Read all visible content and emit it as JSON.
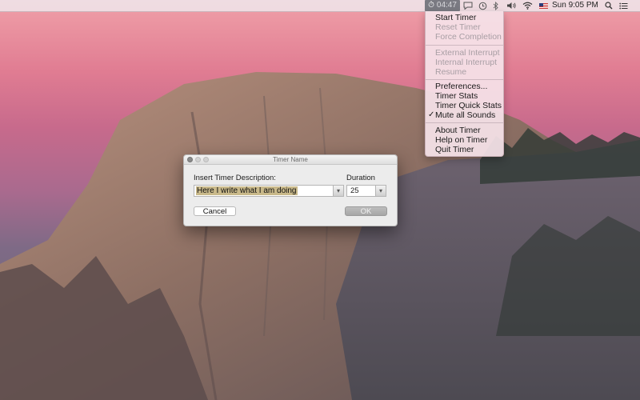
{
  "menubar": {
    "timer_time": "04:47",
    "clock": "Sun 9:05 PM",
    "icons": [
      "stopwatch-icon",
      "chat-bubble-icon",
      "time-machine-icon",
      "bluetooth-icon",
      "volume-icon",
      "wifi-icon",
      "us-flag-icon",
      "spotlight-search-icon",
      "notification-center-icon"
    ]
  },
  "menu": {
    "start_timer": "Start Timer",
    "reset_timer": "Reset Timer",
    "force_completion": "Force Completion",
    "external_interrupt": "External Interrupt",
    "internal_interrupt": "Internal Interrupt",
    "resume": "Resume",
    "preferences": "Preferences...",
    "timer_stats": "Timer Stats",
    "timer_quick_stats": "Timer Quick Stats",
    "mute_all_sounds": "Mute all Sounds",
    "about_timer": "About Timer",
    "help_on_timer": "Help on Timer",
    "quit_timer": "Quit Timer"
  },
  "dialog": {
    "title": "Timer Name",
    "description_label": "Insert Timer Description:",
    "description_value": "Here I write what I am doing",
    "duration_label": "Duration",
    "duration_value": "25",
    "cancel_label": "Cancel",
    "ok_label": "OK"
  }
}
